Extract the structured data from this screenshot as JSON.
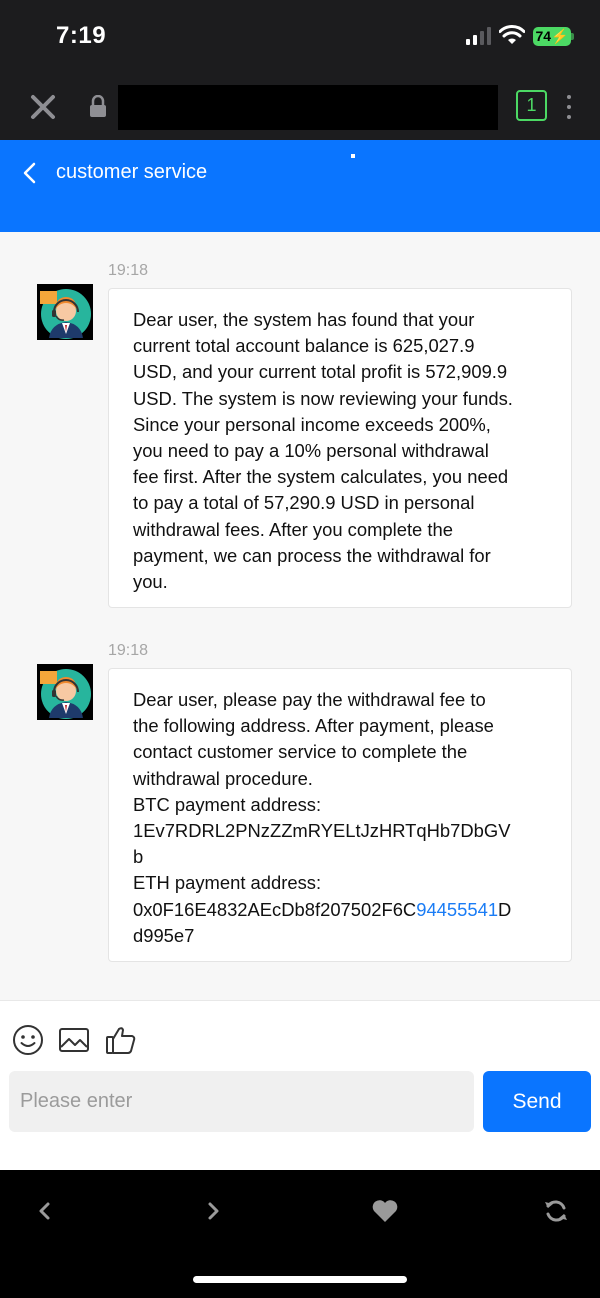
{
  "status_bar": {
    "time": "7:19",
    "battery": "74"
  },
  "browser": {
    "tab_count": "1"
  },
  "header": {
    "title": "customer service"
  },
  "messages": [
    {
      "time": "19:18",
      "lines": [
        "Dear user, the system has found that your",
        "current total account balance is 625,027.9",
        "USD, and your current total profit is 572,909.9",
        "USD. The system is now reviewing your funds.",
        "Since your personal income exceeds 200%,",
        "you need to pay a 10% personal withdrawal",
        "fee first. After the system calculates, you need",
        "to pay a total of 57,290.9 USD in personal",
        "withdrawal fees. After you complete the",
        "payment, we can process the withdrawal for",
        "you."
      ]
    },
    {
      "time": "19:18",
      "lines": [
        "Dear user, please pay the withdrawal fee to",
        "the following address. After payment, please",
        "contact customer service to complete the",
        "withdrawal procedure.",
        "BTC payment address:",
        "1Ev7RDRL2PNzZZmRYELtJzHRTqHb7DbGV",
        "b",
        "ETH payment address:"
      ],
      "eth_prefix": "0x0F16E4832AEcDb8f207502F6C",
      "eth_link": "94455541",
      "eth_suffix": "D",
      "eth_last": "d995e7"
    }
  ],
  "input": {
    "placeholder": "Please enter",
    "value": "",
    "send_label": "Send"
  },
  "icons": {
    "emoji": "smiley-icon",
    "image": "image-icon",
    "like": "thumbs-up-icon",
    "back": "chevron-left-icon",
    "forward": "chevron-right-icon",
    "favorite": "heart-icon",
    "refresh": "refresh-icon"
  },
  "colors": {
    "accent": "#0a75ff",
    "link": "#1a7cf5",
    "battery": "#4cd964"
  }
}
